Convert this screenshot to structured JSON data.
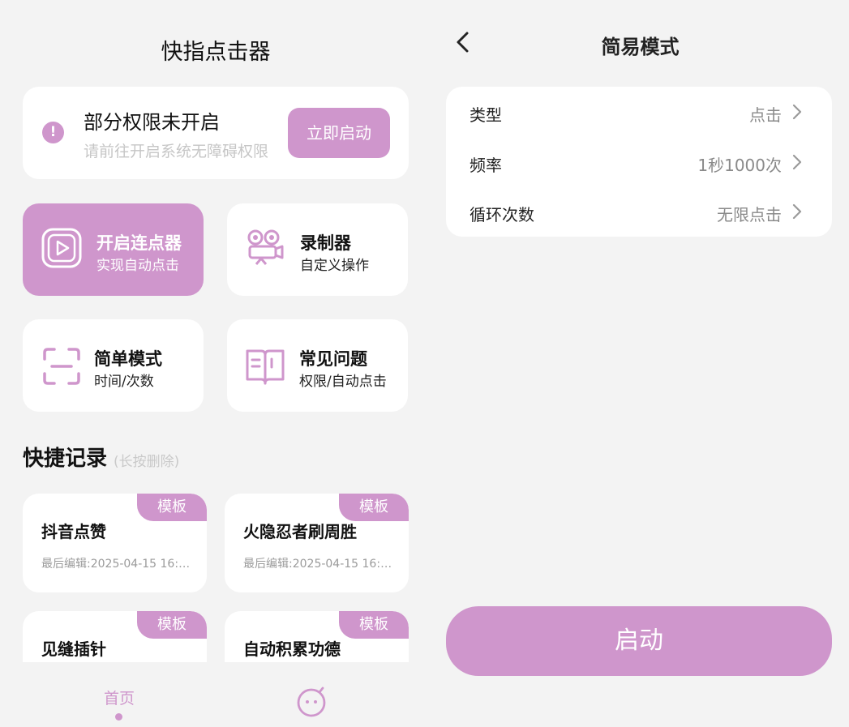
{
  "left": {
    "app_title": "快指点击器",
    "permission": {
      "title": "部分权限未开启",
      "subtitle": "请前往开启系统无障碍权限",
      "button": "立即启动",
      "icon": "warning-icon"
    },
    "tiles": [
      {
        "title": "开启连点器",
        "subtitle": "实现自动点击",
        "icon": "play-icon"
      },
      {
        "title": "录制器",
        "subtitle": "自定义操作",
        "icon": "camera-icon"
      },
      {
        "title": "简单模式",
        "subtitle": "时间/次数",
        "icon": "scan-frame-icon"
      },
      {
        "title": "常见问题",
        "subtitle": "权限/自动点击",
        "icon": "book-icon"
      }
    ],
    "records_title": "快捷记录",
    "records_hint": "(长按删除)",
    "records": [
      {
        "badge": "模板",
        "title": "抖音点赞",
        "time": "最后编辑:2025-04-15 16:1..."
      },
      {
        "badge": "模板",
        "title": "火隐忍者刷周胜",
        "time": "最后编辑:2025-04-15 16:1..."
      },
      {
        "badge": "模板",
        "title": "见缝插针"
      },
      {
        "badge": "模板",
        "title": "自动积累功德"
      }
    ],
    "nav": {
      "home": "首页",
      "profile_icon": "face-icon"
    }
  },
  "right": {
    "title": "简易模式",
    "rows": [
      {
        "label": "类型",
        "value": "点击"
      },
      {
        "label": "频率",
        "value": "1秒1000次"
      },
      {
        "label": "循环次数",
        "value": "无限点击"
      }
    ],
    "start_button": "启动"
  },
  "colors": {
    "accent": "#cf96cc",
    "background": "#f3f3f3",
    "card": "#ffffff"
  }
}
